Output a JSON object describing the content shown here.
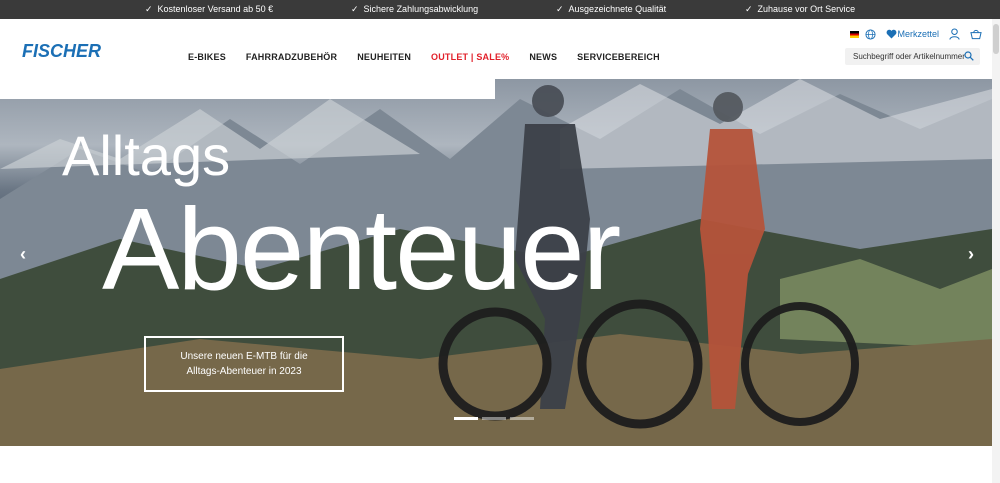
{
  "topbar": {
    "items": [
      {
        "check": "✓",
        "text": "Kostenloser Versand ab 50 €"
      },
      {
        "check": "✓",
        "text": "Sichere Zahlungsabwicklung"
      },
      {
        "check": "✓",
        "text": "Ausgezeichnete Qualität"
      },
      {
        "check": "✓",
        "text": "Zuhause vor Ort Service"
      }
    ]
  },
  "header": {
    "logo": "FISCHER",
    "nav": [
      "E-BIKES",
      "FAHRRADZUBEHÖR",
      "NEUHEITEN",
      "OUTLET | SALE%",
      "NEWS",
      "SERVICEBEREICH"
    ],
    "wishlist_label": "Merkzettel",
    "search_placeholder": "Suchbegriff oder Artikelnummer",
    "accent_color": "#1b6fb5",
    "sale_color": "#e2202a"
  },
  "hero": {
    "headline_small": "Alltags",
    "headline_big": "Abenteuer",
    "cta_line1": "Unsere neuen E-MTB für die",
    "cta_line2": "Alltags-Abenteuer in 2023",
    "prev_arrow": "‹",
    "next_arrow": "›",
    "slide_count": 3,
    "active_slide": 1
  }
}
